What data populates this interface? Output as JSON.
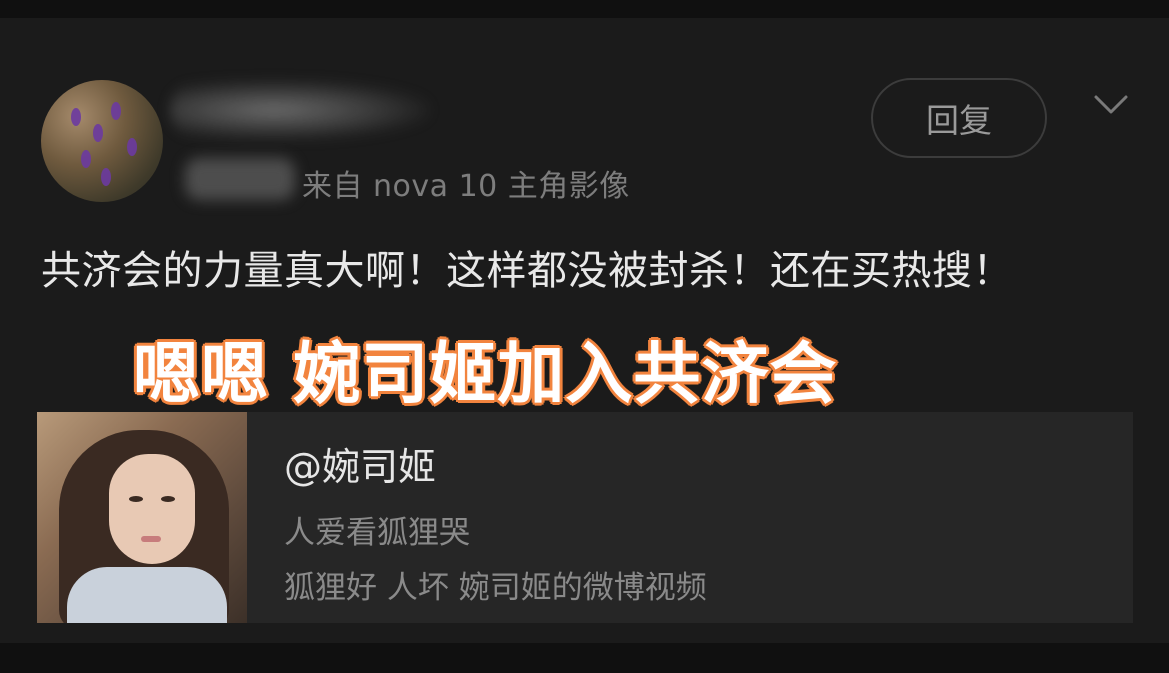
{
  "comment": {
    "source": "来自 nova 10 主角影像",
    "reply_label": "回复",
    "text": "共济会的力量真大啊！这样都没被封杀！还在买热搜！"
  },
  "overlay_caption": "嗯嗯 婉司姬加入共济会",
  "link_card": {
    "title": "@婉司姬",
    "subtitle": "人爱看狐狸哭",
    "description": "狐狸好 人坏 婉司姬的微博视频"
  },
  "icons": {
    "expand": "chevron-down-icon"
  }
}
